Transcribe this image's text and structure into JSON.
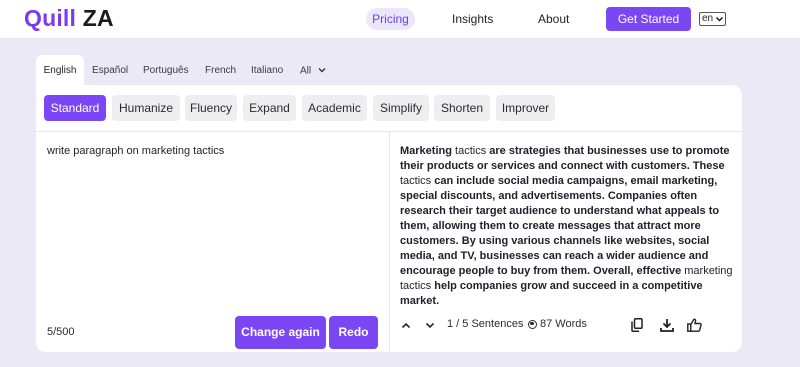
{
  "header": {
    "logo_part1": "Quill",
    "logo_part2": "ZA",
    "nav": {
      "pricing": "Pricing",
      "insights": "Insights",
      "about": "About"
    },
    "cta": "Get Started",
    "language_select": "en"
  },
  "language_tabs": [
    "English",
    "Español",
    "Português",
    "French",
    "Italiano",
    "All"
  ],
  "modes": [
    "Standard",
    "Humanize",
    "Fluency",
    "Expand",
    "Academic",
    "Simplify",
    "Shorten",
    "Improver"
  ],
  "active_mode": "Standard",
  "input": {
    "text": "write paragraph on marketing tactics",
    "char_count": "5/500"
  },
  "buttons": {
    "change_again": "Change again",
    "redo": "Redo"
  },
  "output": {
    "segments": [
      {
        "text": "Marketing ",
        "bold": true
      },
      {
        "text": "tactics",
        "bold": false
      },
      {
        "text": " are strategies that businesses use to promote their products or services and connect with customers. These ",
        "bold": true
      },
      {
        "text": "tactics",
        "bold": false
      },
      {
        "text": " can include social media campaigns, email marketing, special discounts, and advertisements. Companies often research their target audience to understand what appeals to them, allowing them to create messages that attract more customers. By using various channels like websites, social media, and TV, businesses can reach a wider audience and encourage people to buy from them. Overall, effective ",
        "bold": true
      },
      {
        "text": "marketing tactics",
        "bold": false
      },
      {
        "text": " help companies grow and succeed in a competitive market.",
        "bold": true
      }
    ],
    "sentences": "1 / 5 Sentences",
    "words": "87 Words"
  },
  "icons": {
    "prev": "chevron-up-icon",
    "next": "chevron-down-icon",
    "copy": "copy-icon",
    "download": "download-icon",
    "like": "thumbs-up-icon",
    "all_tabs": "chevron-down-icon"
  },
  "colors": {
    "accent": "#7b47f5",
    "pricing_bg": "#ece6fb",
    "page_bg": "#ece9f6"
  }
}
